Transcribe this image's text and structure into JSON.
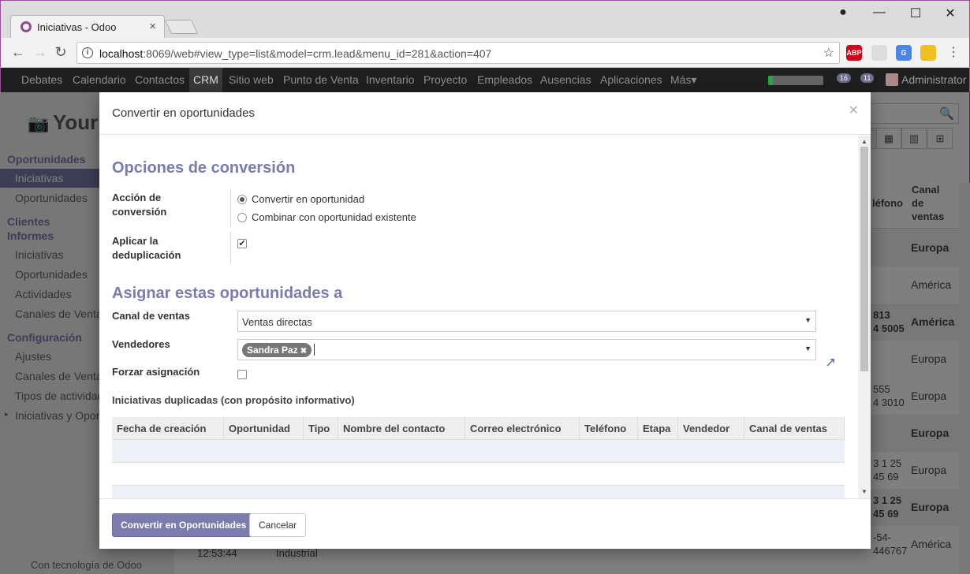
{
  "browser": {
    "tab_title": "Iniciativas - Odoo",
    "url_host": "localhost",
    "url_rest": ":8069/web#view_type=list&model=crm.lead&menu_id=281&action=407",
    "extensions": [
      {
        "name": "adblock-icon",
        "label": "ABP",
        "color": "#d0021b"
      },
      {
        "name": "puzzle-icon",
        "label": "",
        "color": "#dddddd"
      },
      {
        "name": "translate-icon",
        "label": "G",
        "color": "#4a86e8"
      },
      {
        "name": "python-icon",
        "label": "",
        "color": "#f0c020"
      }
    ]
  },
  "odoo_nav": {
    "items": [
      "Debates",
      "Calendario",
      "Contactos",
      "CRM",
      "Sitio web",
      "Punto de Venta",
      "Inventario",
      "Proyecto",
      "Empleados",
      "Ausencias",
      "Aplicaciones",
      "Más▾"
    ],
    "active": "CRM",
    "badge_1": "16",
    "badge_2": "11",
    "user": "Administrator"
  },
  "sidebar": {
    "logo": "Your",
    "sections": [
      {
        "head": "Oportunidades",
        "items": [
          "Iniciativas",
          "Oportunidades"
        ]
      },
      {
        "head": "Clientes",
        "items": []
      },
      {
        "head": "Informes",
        "items": [
          "Iniciativas",
          "Oportunidades",
          "Actividades",
          "Canales de Ventas"
        ]
      },
      {
        "head": "Configuración",
        "items": [
          "Ajustes",
          "Canales de Ventas",
          "Tipos de actividad",
          "Iniciativas y Oportu"
        ]
      }
    ],
    "footer": "Con tecnología de Odoo"
  },
  "background_list": {
    "headers": [
      "léfono",
      "Canal de ventas"
    ],
    "rows": [
      {
        "phone": "",
        "channel": "Europa",
        "bold": true
      },
      {
        "phone": "",
        "channel": "América",
        "bold": false
      },
      {
        "phone": "813\n4 5005",
        "channel": "América",
        "bold": true
      },
      {
        "phone": "",
        "channel": "Europa",
        "bold": false
      },
      {
        "phone": "555\n4 3010",
        "channel": "Europa",
        "bold": false
      },
      {
        "phone": "",
        "channel": "Europa",
        "bold": true
      },
      {
        "phone": "3 1 25\n45 69",
        "channel": "Europa",
        "bold": false
      },
      {
        "phone": "3 1 25\n45 69",
        "channel": "Europa",
        "bold": true
      },
      {
        "phone": "-54-\n446767",
        "channel": "América",
        "bold": false
      }
    ],
    "bottom_time": "12:53:44",
    "bottom_text": "Industrial"
  },
  "modal": {
    "title": "Convertir en oportunidades",
    "section1": "Opciones de conversión",
    "action_label": "Acción de conversión",
    "radio_convert": "Convertir en oportunidad",
    "radio_merge": "Combinar con oportunidad existente",
    "dedup_label": "Aplicar la deduplicación",
    "dedup_checked": true,
    "section2": "Asignar estas oportunidades a",
    "channel_label": "Canal de ventas",
    "channel_value": "Ventas directas",
    "sellers_label": "Vendedores",
    "seller_tag": "Sandra Paz",
    "force_label": "Forzar asignación",
    "force_checked": false,
    "dup_title": "Iniciativas duplicadas (con propósito informativo)",
    "columns": [
      "Fecha de creación",
      "Oportunidad",
      "Tipo",
      "Nombre del contacto",
      "Correo electrónico",
      "Teléfono",
      "Etapa",
      "Vendedor",
      "Canal de ventas"
    ],
    "btn_convert": "Convertir en Oportunidades",
    "btn_cancel": "Cancelar"
  }
}
